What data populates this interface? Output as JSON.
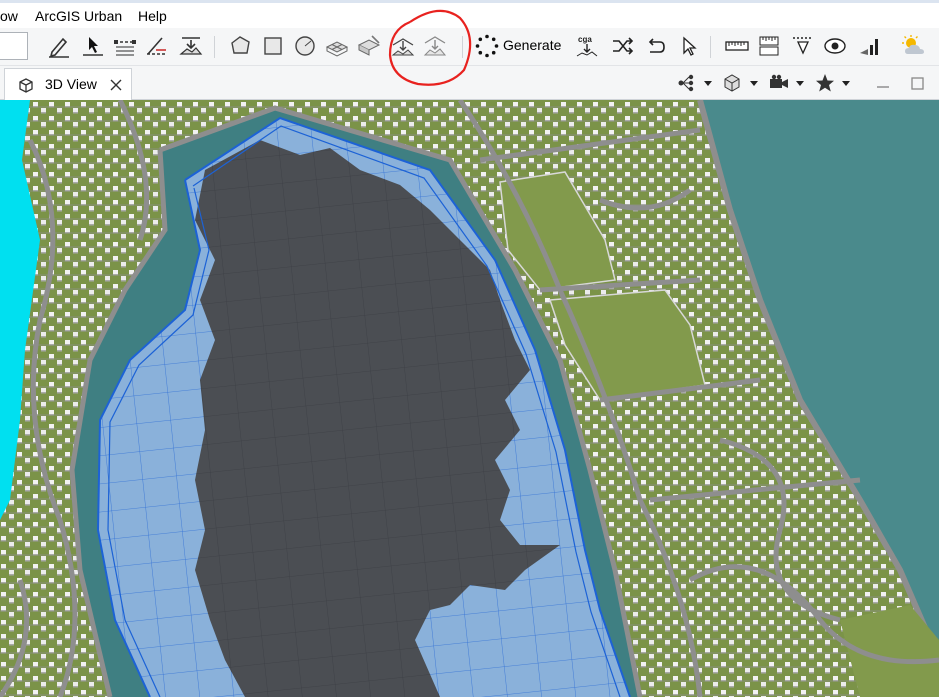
{
  "menubar": {
    "items": [
      "ow",
      "ArcGIS Urban",
      "Help"
    ]
  },
  "toolbar": {
    "generate_label": "Generate",
    "cga_badge": "cga",
    "tools": [
      "edit-shape-icon",
      "insert-point-icon",
      "split-edge-icon",
      "measure-angle-icon",
      "align-terrain-icon",
      "polygon-select-icon",
      "rectangle-select-icon",
      "circle-select-icon",
      "block-subdivide-icon",
      "lot-edit-icon",
      "extrude-shape-icon",
      "align-to-terrain-icon",
      "drop-to-terrain-icon",
      "generate-icon",
      "cga-rule-icon",
      "random-seed-icon",
      "undo-generate-icon",
      "select-cursor-icon",
      "ruler-icon",
      "area-measure-icon",
      "height-measure-icon",
      "visibility-icon",
      "analysis-icon",
      "weather-icon"
    ]
  },
  "view_tab": {
    "title": "3D View",
    "view_tools": [
      "scene-graph-icon",
      "layer-display-icon",
      "camera-bookmarks-icon",
      "star-favorites-icon"
    ]
  },
  "viewport": {
    "colors": {
      "water": "#4a8a8c",
      "deep_water": "#3f7f82",
      "lake": "#00e0f0",
      "terrain": "#7b9348",
      "roads": "#8e8e8e",
      "selection_fill": "#8ab1da",
      "selection_line": "#1c62d6",
      "shadow": "#4b4e53",
      "highlight": "#e8221f"
    }
  }
}
